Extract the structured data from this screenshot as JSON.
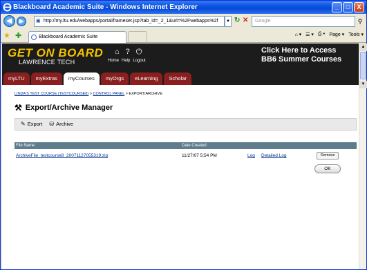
{
  "window": {
    "title": "Blackboard Academic Suite - Windows Internet Explorer",
    "buttons": [
      "_",
      "□",
      "X"
    ]
  },
  "address_bar": {
    "url": "http://my.ltu.edu/webapps/portal/frameset.jsp?tab_id=_2_1&url=%2Fwebapps%2f",
    "search_placeholder": "Google"
  },
  "browser_tab": {
    "label": "Blackboard Academic Suite"
  },
  "browser_tools": {
    "page": "Page",
    "tools": "Tools"
  },
  "header": {
    "logo_line1": "GET ON BOARD",
    "logo_line2": "LAWRENCE TECH",
    "links": [
      "Home",
      "Help",
      "Logout"
    ],
    "promo_line1": "Click Here to Access",
    "promo_line2": "BB6 Summer Courses"
  },
  "nav_tabs": [
    {
      "label": "myLTU",
      "active": false
    },
    {
      "label": "myExtras",
      "active": false
    },
    {
      "label": "myCourses",
      "active": true
    },
    {
      "label": "myOrgs",
      "active": false
    },
    {
      "label": "eLearning",
      "active": false
    },
    {
      "label": "Scholar",
      "active": false
    }
  ],
  "breadcrumb": {
    "course": "LINDA'S TEST COURSE (TESTCOURSE8)",
    "control_panel": "CONTROL PANEL",
    "current": "EXPORT/ARCHIVE",
    "separator": " > "
  },
  "page_title": "Export/Archive Manager",
  "actions": {
    "export": "Export",
    "archive": "Archive"
  },
  "table": {
    "headers": [
      "File Name",
      "Date Created"
    ],
    "rows": [
      {
        "file_name": "ArchiveFile_testcourse8_20071127055319.zip",
        "date": "11/27/07 5:54 PM",
        "log": "Log",
        "detailed_log": "Detailed Log",
        "remove": "Remove"
      }
    ]
  },
  "ok_label": "OK"
}
